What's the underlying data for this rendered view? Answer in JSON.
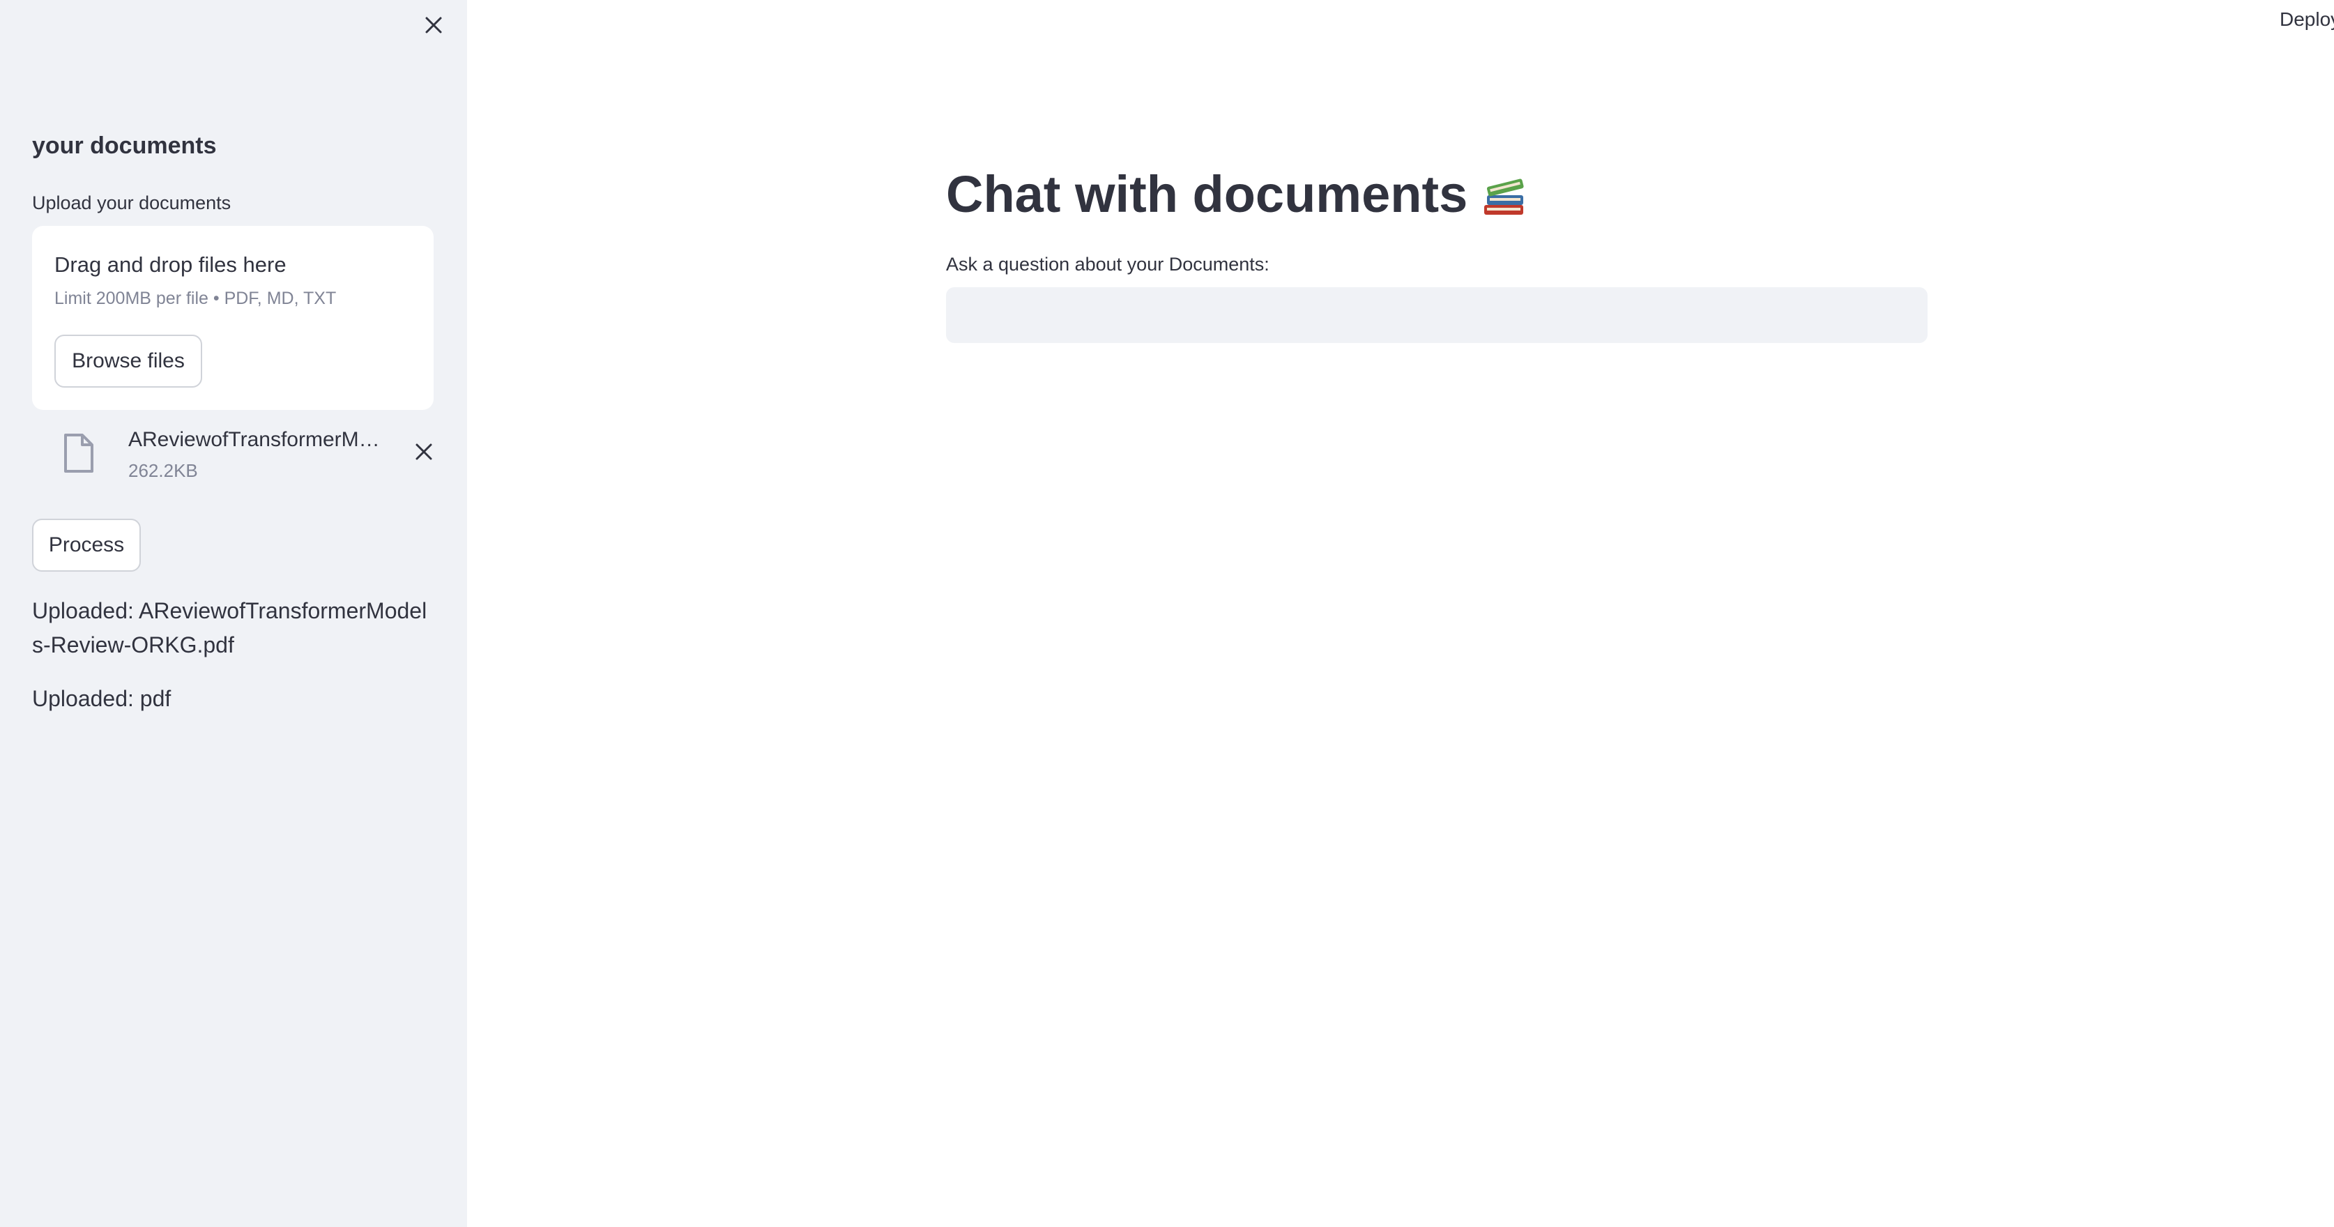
{
  "sidebar": {
    "close_icon": "close-icon",
    "heading": "your documents",
    "upload_label": "Upload your documents",
    "dropzone": {
      "title": "Drag and drop files here",
      "limit": "Limit 200MB per file • PDF, MD, TXT",
      "browse_label": "Browse files"
    },
    "file": {
      "icon": "file-icon",
      "name": "AReviewofTransformerModels-Review-ORKG.pdf",
      "name_display": "AReviewofTransformerM…",
      "size": "262.2KB",
      "remove_icon": "close-icon"
    },
    "process_label": "Process",
    "uploaded_messages": [
      "Uploaded: AReviewofTransformerModels-Review-ORKG.pdf",
      "Uploaded: pdf"
    ]
  },
  "header": {
    "deploy_label": "Deploy"
  },
  "main": {
    "title": "Chat with documents",
    "title_icon": "books-icon",
    "question_label": "Ask a question about your Documents:",
    "question_value": "",
    "question_placeholder": ""
  },
  "colors": {
    "sidebar_bg": "#f0f2f6",
    "text": "#31333f",
    "muted_text": "#808495",
    "input_bg": "#f0f2f6",
    "button_border": "#d0d3d9"
  }
}
